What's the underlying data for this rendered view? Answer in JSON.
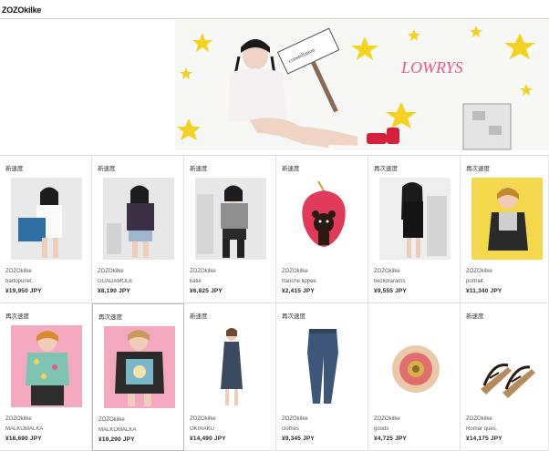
{
  "header": {
    "logo": "ZOZOkilke"
  },
  "banner": {
    "sign_text": "constellation",
    "brand_script": "LOWRYS"
  },
  "products": [
    {
      "badge": "新速度",
      "brand": "ZOZOkilke",
      "name": "bartopunet.",
      "price": "¥19,950 JPY",
      "icon": "model-with-bag-thumbnail",
      "bg": "#e9e9e9"
    },
    {
      "badge": "新速度",
      "brand": "ZOZOkilke",
      "name": "GUADAMOLE",
      "price": "¥8,190 JPY",
      "icon": "model-dark-top-thumbnail",
      "bg": "#e7e7e7"
    },
    {
      "badge": "新速度",
      "brand": "ZOZOkilke",
      "name": "katie",
      "price": "¥6,825 JPY",
      "icon": "model-grey-tee-thumbnail",
      "bg": "#e8e8e8"
    },
    {
      "badge": "新速度",
      "brand": "ZOZOkilke",
      "name": "franche lippee",
      "price": "¥2,415 JPY",
      "icon": "strawberry-bear-charm-thumbnail",
      "bg": "#ffffff"
    },
    {
      "badge": "再次速度",
      "brand": "ZOZOkilke",
      "name": "bezlidrarams",
      "price": "¥9,555 JPY",
      "icon": "model-black-dress-thumbnail",
      "bg": "#eeeeee"
    },
    {
      "badge": "再次速度",
      "brand": "ZOZOkilke",
      "name": "portrait.",
      "price": "¥11,340 JPY",
      "icon": "model-yellow-bg-thumbnail",
      "bg": "#f2d84a"
    },
    {
      "badge": "再次速度",
      "brand": "ZOZOkilke",
      "name": "MALKOMALKA",
      "price": "¥18,690 JPY",
      "icon": "model-floral-jacket-thumbnail",
      "bg": "#f5a9c1"
    },
    {
      "badge": "再次速度",
      "brand": "ZOZOkilke",
      "name": "MALKOMALKA",
      "price": "¥10,290 JPY",
      "icon": "model-print-tee-thumbnail",
      "bg": "#f3a8bf"
    },
    {
      "badge": "新速度",
      "brand": "ZOZOkilke",
      "name": "OKIRAKU",
      "price": "¥14,490 JPY",
      "icon": "model-navy-dress-thumbnail",
      "bg": "#ffffff"
    },
    {
      "badge": "再次速度",
      "brand": "ZOZOkilke",
      "name": "clothes",
      "price": "¥9,345 JPY",
      "icon": "denim-jeans-thumbnail",
      "bg": "#ffffff"
    },
    {
      "badge": "",
      "brand": "ZOZOkilke",
      "name": "goods",
      "price": "¥4,725 JPY",
      "icon": "lace-corsage-thumbnail",
      "bg": "#ffffff"
    },
    {
      "badge": "新速度",
      "brand": "ZOZOkilke",
      "name": "Romar ques.",
      "price": "¥14,175 JPY",
      "icon": "strappy-sandals-thumbnail",
      "bg": "#ffffff"
    }
  ]
}
